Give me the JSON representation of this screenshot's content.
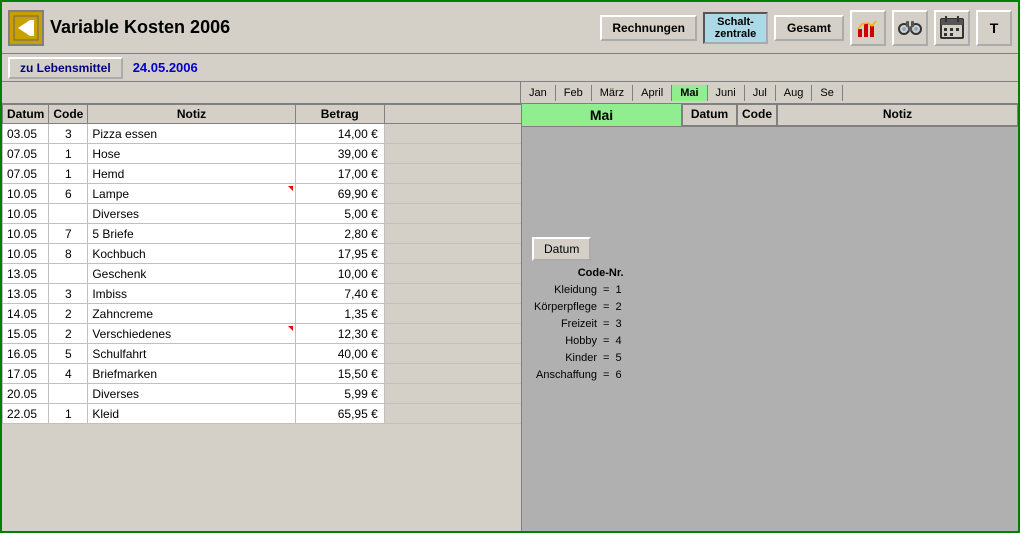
{
  "window": {
    "title": "Variable Kosten  2006",
    "border_color": "#008000"
  },
  "toolbar": {
    "app_icon": "→",
    "rechnungen_label": "Rechnungen",
    "schalt_label": "Schalt-\nzentrale",
    "gesamt_label": "Gesamt",
    "nav_label": "zu Lebensmittel",
    "date_label": "24.05.2006"
  },
  "months": {
    "tabs": [
      "Jan",
      "Feb",
      "März",
      "April",
      "Mai",
      "Juni",
      "Jul",
      "Aug",
      "Se"
    ],
    "active": "Mai"
  },
  "table_headers": {
    "datum": "Datum",
    "code": "Code",
    "notiz": "Notiz",
    "betrag": "Betrag"
  },
  "rows": [
    {
      "datum": "03.05",
      "code": "3",
      "notiz": "Pizza essen",
      "betrag": "14,00 €",
      "triangle": false
    },
    {
      "datum": "07.05",
      "code": "1",
      "notiz": "Hose",
      "betrag": "39,00 €",
      "triangle": false
    },
    {
      "datum": "07.05",
      "code": "1",
      "notiz": "Hemd",
      "betrag": "17,00 €",
      "triangle": false
    },
    {
      "datum": "10.05",
      "code": "6",
      "notiz": "Lampe",
      "betrag": "69,90 €",
      "triangle": true
    },
    {
      "datum": "10.05",
      "code": "",
      "notiz": "Diverses",
      "betrag": "5,00 €",
      "triangle": false
    },
    {
      "datum": "10.05",
      "code": "7",
      "notiz": "5 Briefe",
      "betrag": "2,80 €",
      "triangle": false
    },
    {
      "datum": "10.05",
      "code": "8",
      "notiz": "Kochbuch",
      "betrag": "17,95 €",
      "triangle": false
    },
    {
      "datum": "13.05",
      "code": "",
      "notiz": "Geschenk",
      "betrag": "10,00 €",
      "triangle": false
    },
    {
      "datum": "13.05",
      "code": "3",
      "notiz": "Imbiss",
      "betrag": "7,40 €",
      "triangle": false
    },
    {
      "datum": "14.05",
      "code": "2",
      "notiz": "Zahncreme",
      "betrag": "1,35 €",
      "triangle": false
    },
    {
      "datum": "15.05",
      "code": "2",
      "notiz": "Verschiedenes",
      "betrag": "12,30 €",
      "triangle": true
    },
    {
      "datum": "16.05",
      "code": "5",
      "notiz": "Schulfahrt",
      "betrag": "40,00 €",
      "triangle": false
    },
    {
      "datum": "17.05",
      "code": "4",
      "notiz": "Briefmarken",
      "betrag": "15,50 €",
      "triangle": false
    },
    {
      "datum": "20.05",
      "code": "",
      "notiz": "Diverses",
      "betrag": "5,99 €",
      "triangle": false
    },
    {
      "datum": "22.05",
      "code": "1",
      "notiz": "Kleid",
      "betrag": "65,95 €",
      "triangle": false
    }
  ],
  "right_panel": {
    "month_label": "Mai",
    "datum_btn": "Datum",
    "code_title": "Code-Nr.",
    "code_items": [
      {
        "label": "Kleidung",
        "eq": "=",
        "num": "1"
      },
      {
        "label": "Körperpflege",
        "eq": "=",
        "num": "2"
      },
      {
        "label": "Freizeit",
        "eq": "=",
        "num": "3"
      },
      {
        "label": "Hobby",
        "eq": "=",
        "num": "4"
      },
      {
        "label": "Kinder",
        "eq": "=",
        "num": "5"
      },
      {
        "label": "Anschaffung",
        "eq": "=",
        "num": "6"
      }
    ]
  },
  "right_table_headers": {
    "datum": "Datum",
    "code": "Code",
    "notiz": "Notiz"
  }
}
